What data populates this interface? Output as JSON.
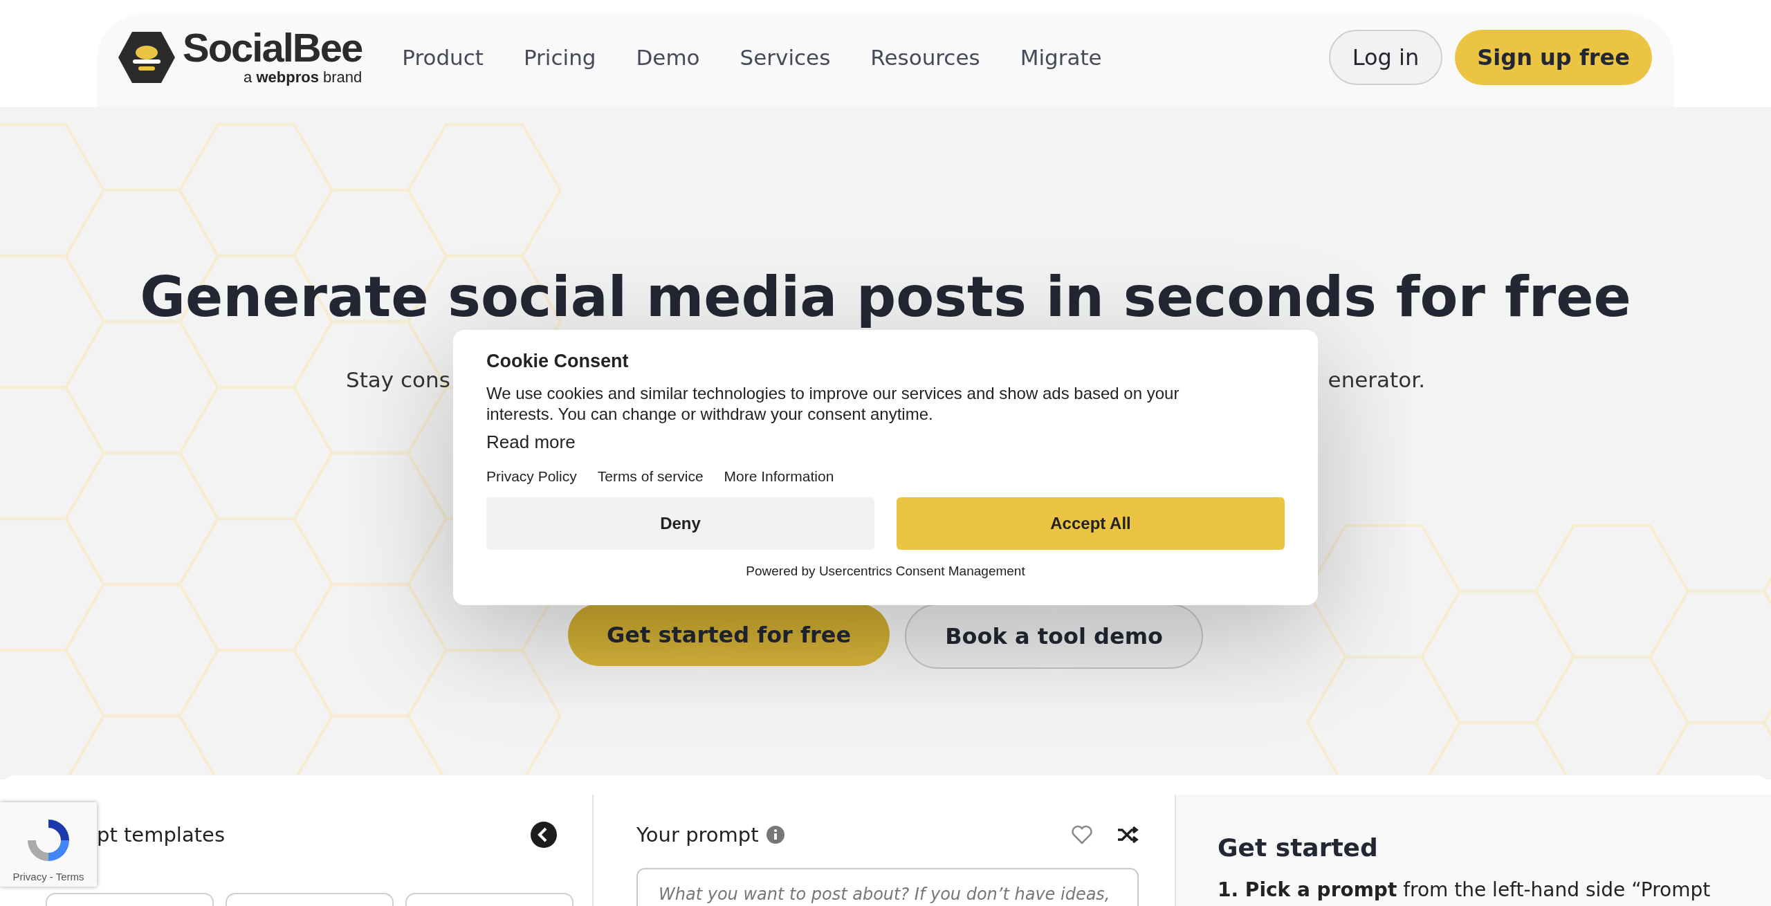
{
  "header": {
    "logo": {
      "name": "SocialBee",
      "tagline": "a **webpros** brand"
    },
    "nav": [
      {
        "label": "Product"
      },
      {
        "label": "Pricing"
      },
      {
        "label": "Demo"
      },
      {
        "label": "Services"
      },
      {
        "label": "Resources"
      },
      {
        "label": "Migrate"
      }
    ],
    "actions": [
      {
        "label": "Log in",
        "kind": "outline"
      },
      {
        "label": "Sign up free",
        "kind": "primary"
      }
    ]
  },
  "hero": {
    "title": "Generate social media posts in seconds for free",
    "subtitle_left": "Stay cons",
    "subtitle_right": "enerator.",
    "buttons": [
      {
        "label": "Get started for free",
        "kind": "primary"
      },
      {
        "label": "Book a tool demo",
        "kind": "outline"
      }
    ]
  },
  "cookie_dialog": {
    "title": "Cookie Consent",
    "body": "We use cookies and similar technologies to improve our services and show ads based on your interests. You can change or withdraw your consent anytime.",
    "read_more": "Read more",
    "links": [
      "Privacy Policy",
      "Terms of service",
      "More Information"
    ],
    "buttons": [
      {
        "label": "Deny",
        "kind": "secondary"
      },
      {
        "label": "Accept All",
        "kind": "primary"
      }
    ],
    "footer": "Powered by Usercentrics Consent Management"
  },
  "tool": {
    "templates": {
      "title": "pt templates"
    },
    "prompt": {
      "title": "Your prompt",
      "placeholder": "What you want to post about? If you don’t have ideas,"
    },
    "get_started": {
      "title": "Get started",
      "step": "**1. Pick a prompt** from the left-hand side “Prompt"
    }
  },
  "recaptcha": {
    "links": "Privacy - Terms"
  }
}
